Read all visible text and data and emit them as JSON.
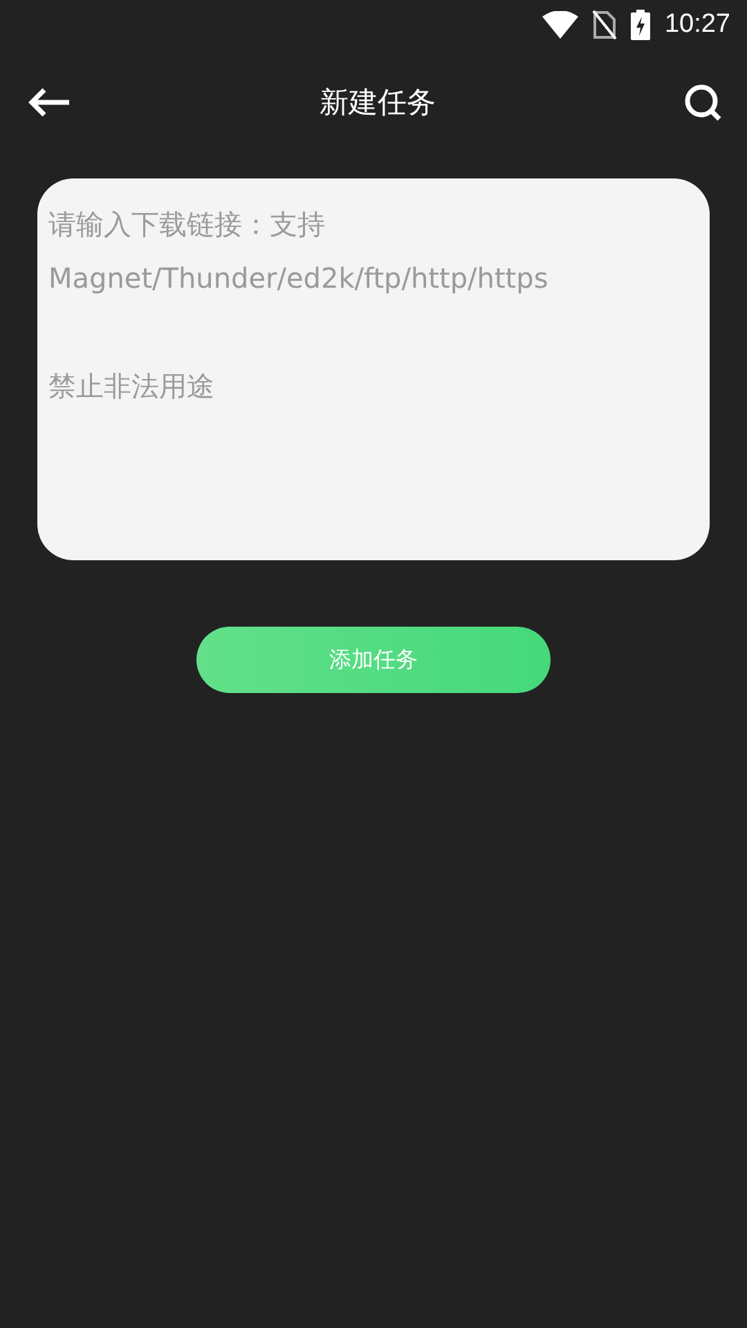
{
  "status_bar": {
    "time": "10:27"
  },
  "header": {
    "title": "新建任务"
  },
  "link_input": {
    "placeholder": "请输入下载链接：支持 Magnet/Thunder/ed2k/ftp/http/https\n\n禁止非法用途"
  },
  "add_button": {
    "label": "添加任务"
  }
}
